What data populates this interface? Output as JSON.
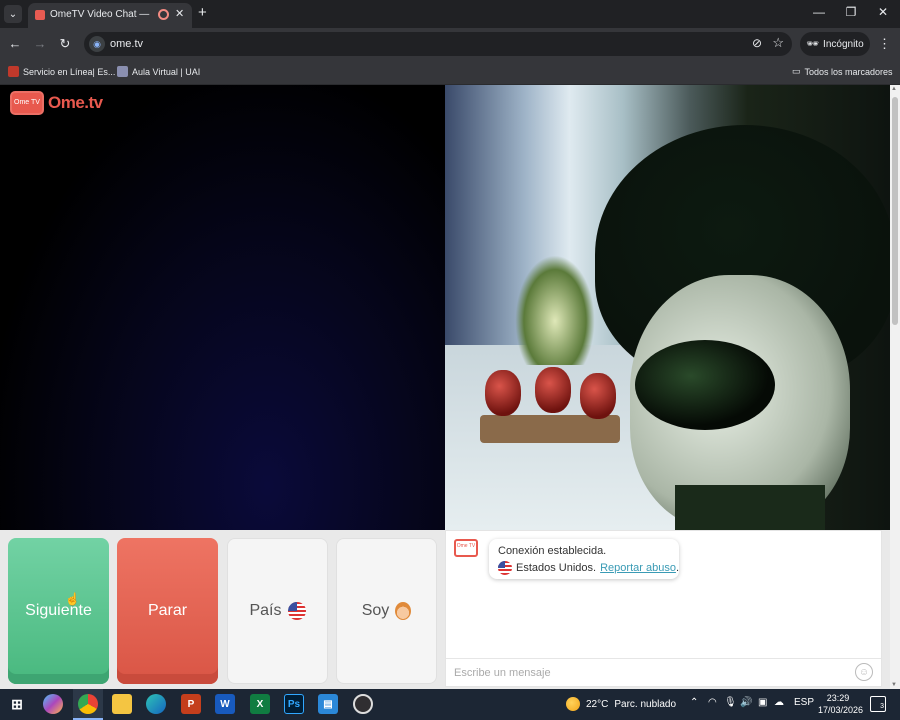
{
  "browser": {
    "tab": {
      "title": "OmeTV Video Chat — Omegle"
    },
    "url": "ome.tv",
    "profile_label": "Incógnito",
    "bookmarks": [
      {
        "label": "Servicio en Línea| Es..."
      },
      {
        "label": "Aula Virtual | UAI"
      }
    ],
    "all_bookmarks_label": "Todos los marcadores"
  },
  "site": {
    "logo_badge": "Ome TV",
    "logo_text": "Ome.tv",
    "controls": {
      "next": "Siguiente",
      "stop": "Parar",
      "country": "País",
      "gender": "Soy"
    },
    "chat": {
      "avatar_label": "Ome TV",
      "status_message": "Conexión establecida.",
      "country_text": "Estados Unidos.",
      "report_link": "Reportar abuso",
      "report_suffix": ".",
      "input_placeholder": "Escribe un mensaje"
    }
  },
  "taskbar": {
    "weather_temp": "22°C",
    "weather_desc": "Parc. nublado",
    "language": "ESP",
    "time": "23:29",
    "date": "17/03/2026",
    "notification_count": "3",
    "apps": [
      "windows-start",
      "copilot",
      "chrome",
      "file-explorer",
      "edge",
      "powerpoint",
      "word",
      "excel",
      "photoshop",
      "store",
      "obs"
    ]
  },
  "colors": {
    "next_button": "#48b87e",
    "stop_button": "#d95545",
    "brand": "#e8594e",
    "link": "#3a9bb5"
  }
}
